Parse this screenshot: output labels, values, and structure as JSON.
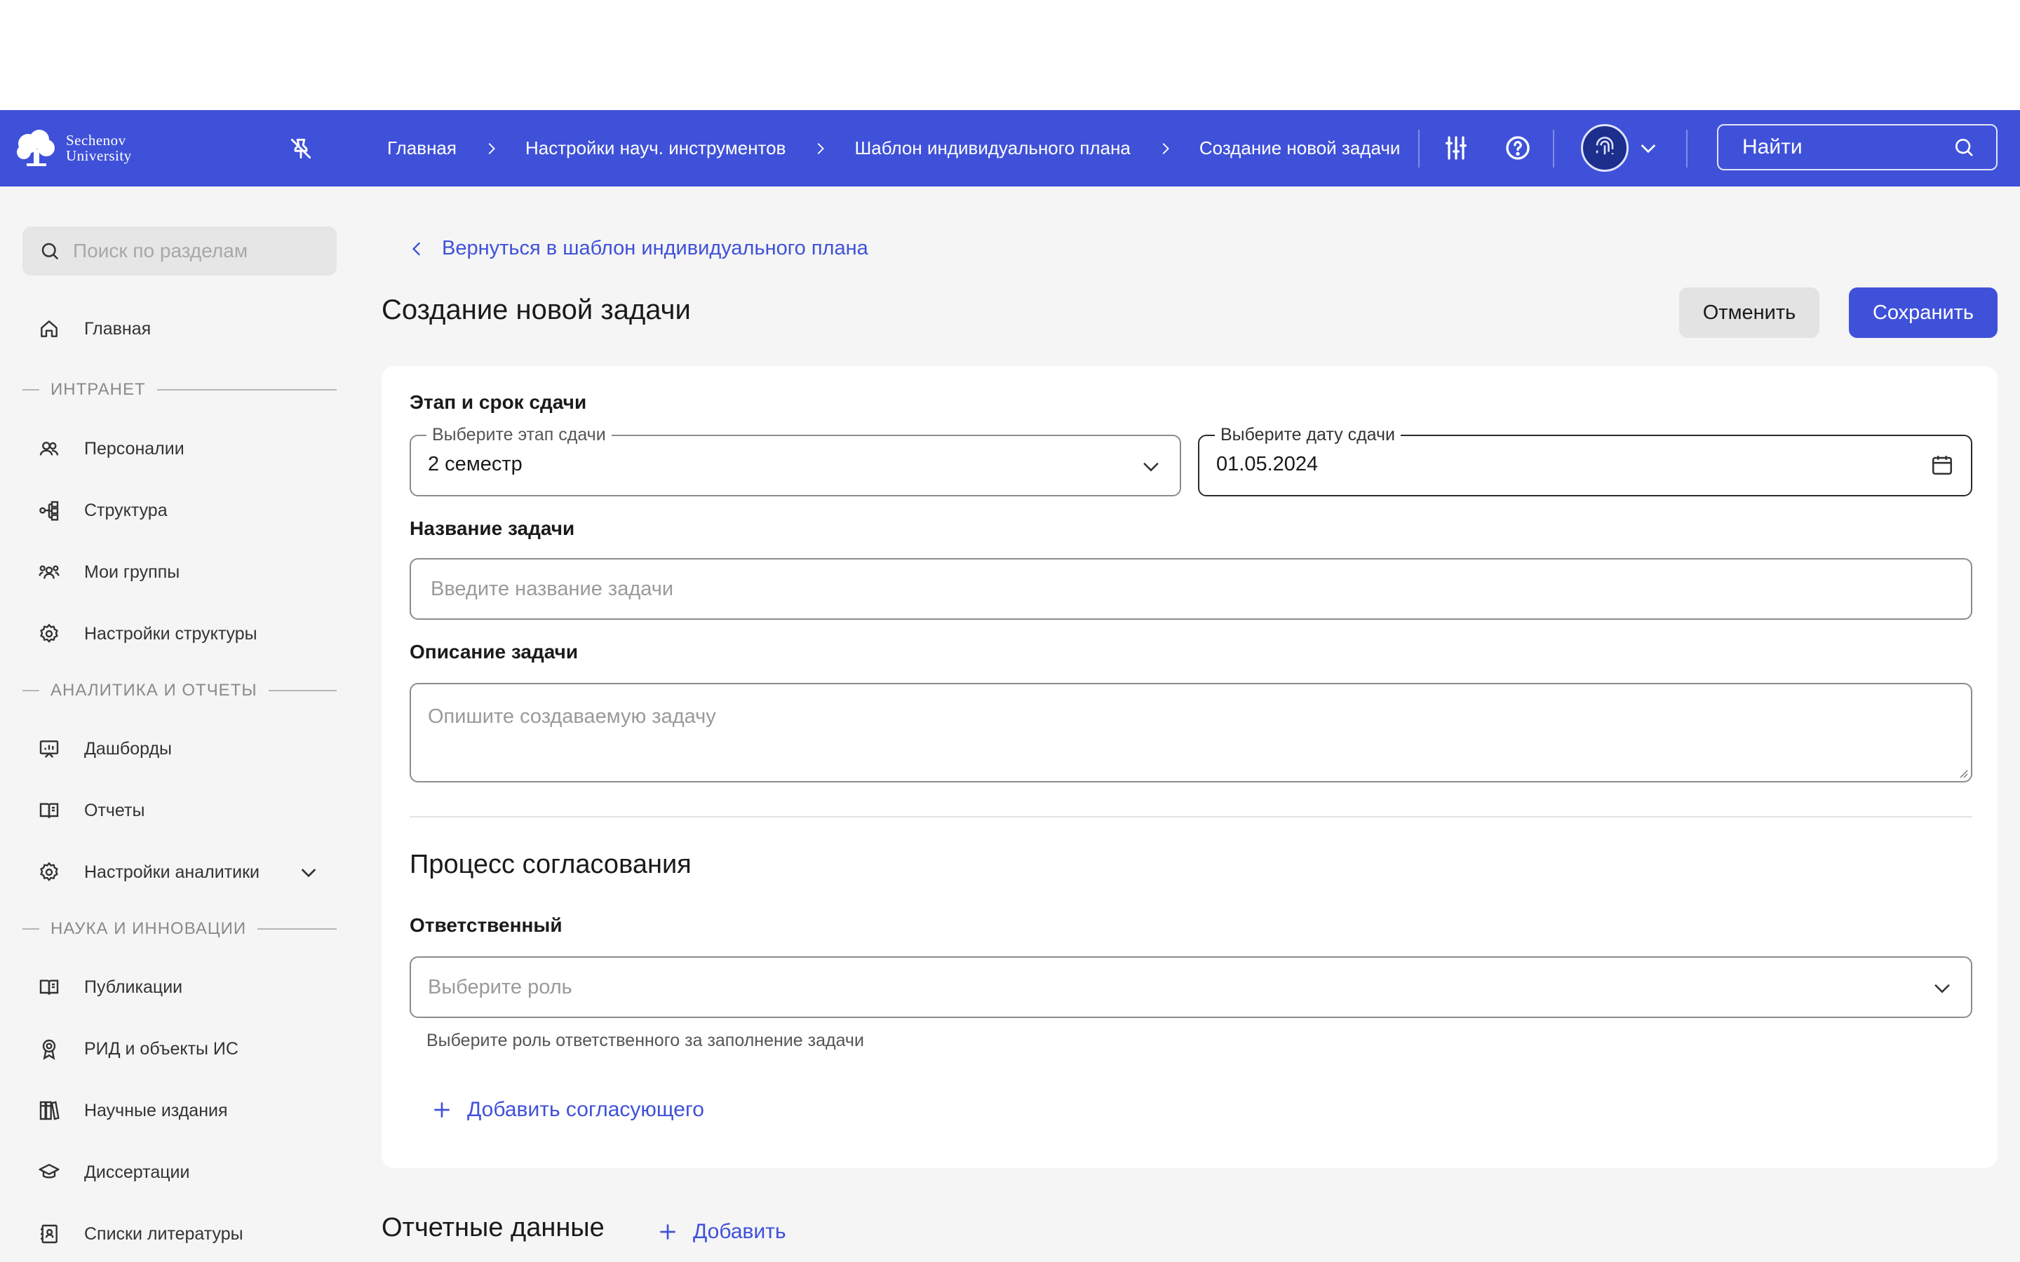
{
  "header": {
    "logo_line1": "Sechenov",
    "logo_line2": "University",
    "breadcrumbs": [
      "Главная",
      "Настройки науч. инструментов",
      "Шаблон индивидуального плана",
      "Создание новой задачи"
    ],
    "search_placeholder": "Найти"
  },
  "sidebar": {
    "search_placeholder": "Поиск по разделам",
    "items": [
      {
        "label": "Главная",
        "icon": "home-icon"
      },
      {
        "label": "Персоналии",
        "icon": "people-icon"
      },
      {
        "label": "Структура",
        "icon": "structure-icon"
      },
      {
        "label": "Мои группы",
        "icon": "groups-icon"
      },
      {
        "label": "Настройки структуры",
        "icon": "gear-icon"
      },
      {
        "label": "Дашборды",
        "icon": "dashboard-icon"
      },
      {
        "label": "Отчеты",
        "icon": "book-icon"
      },
      {
        "label": "Настройки аналитики",
        "icon": "gear-icon"
      },
      {
        "label": "Публикации",
        "icon": "book-icon"
      },
      {
        "label": "РИД и объекты ИС",
        "icon": "award-icon"
      },
      {
        "label": "Научные издания",
        "icon": "books-icon"
      },
      {
        "label": "Диссертации",
        "icon": "graduation-icon"
      },
      {
        "label": "Списки литературы",
        "icon": "contacts-icon"
      }
    ],
    "sections": [
      "ИНТРАНЕТ",
      "АНАЛИТИКА И ОТЧЕТЫ",
      "НАУКА И ИННОВАЦИИ"
    ]
  },
  "page": {
    "back_link": "Вернуться в шаблон индивидуального плана",
    "title": "Создание новой задачи",
    "cancel_label": "Отменить",
    "save_label": "Сохранить"
  },
  "form": {
    "stage_section": "Этап и срок сдачи",
    "stage_legend": "Выберите этап сдачи",
    "stage_value": "2 семестр",
    "date_legend": "Выберите дату сдачи",
    "date_value": "01.05.2024",
    "name_label": "Название задачи",
    "name_placeholder": "Введите название задачи",
    "desc_label": "Описание задачи",
    "desc_placeholder": "Опишите создаваемую задачу",
    "approval_title": "Процесс согласования",
    "responsible_label": "Ответственный",
    "role_placeholder": "Выберите роль",
    "role_hint": "Выберите роль ответственного за заполнение задачи",
    "add_approver": "Добавить согласующего"
  },
  "report": {
    "title": "Отчетные данные",
    "add_label": "Добавить"
  },
  "colors": {
    "accent": "#3f51d8",
    "background": "#f5f5f5"
  }
}
